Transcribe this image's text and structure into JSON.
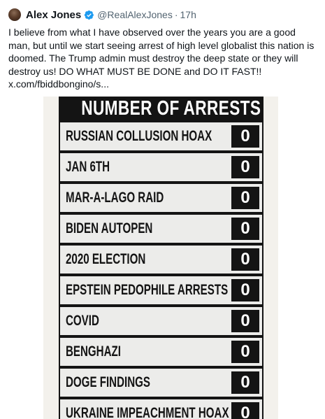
{
  "author": {
    "name": "Alex Jones",
    "handle": "@RealAlexJones",
    "separator": "·",
    "time": "17h"
  },
  "tweet": {
    "text": "I believe from what I have observed over the years you are a good man, but until we start seeing arrest of high level globalist this nation is doomed. The Trump admin must destroy the deep state or they will destroy us! DO WHAT MUST BE DONE and DO IT FAST!!",
    "link": "x.com/fbiddbongino/s..."
  },
  "media": {
    "title": "NUMBER OF ARRESTS",
    "rows": [
      {
        "label": "RUSSIAN COLLUSION HOAX",
        "count": "0"
      },
      {
        "label": "JAN 6TH",
        "count": "0"
      },
      {
        "label": "MAR-A-LAGO RAID",
        "count": "0"
      },
      {
        "label": "BIDEN AUTOPEN",
        "count": "0"
      },
      {
        "label": "2020 ELECTION",
        "count": "0"
      },
      {
        "label": "EPSTEIN PEDOPHILE ARRESTS",
        "count": "0"
      },
      {
        "label": "COVID",
        "count": "0"
      },
      {
        "label": "BENGHAZI",
        "count": "0"
      },
      {
        "label": "DOGE FINDINGS",
        "count": "0"
      },
      {
        "label": "UKRAINE IMPEACHMENT HOAX",
        "count": "0"
      }
    ]
  },
  "colors": {
    "text": "#0f1419",
    "secondary": "#536471",
    "verified": "#1d9bf0",
    "board": "#141414",
    "row_bg": "#ececea"
  },
  "icons": {
    "verified": "verified-badge-icon"
  }
}
